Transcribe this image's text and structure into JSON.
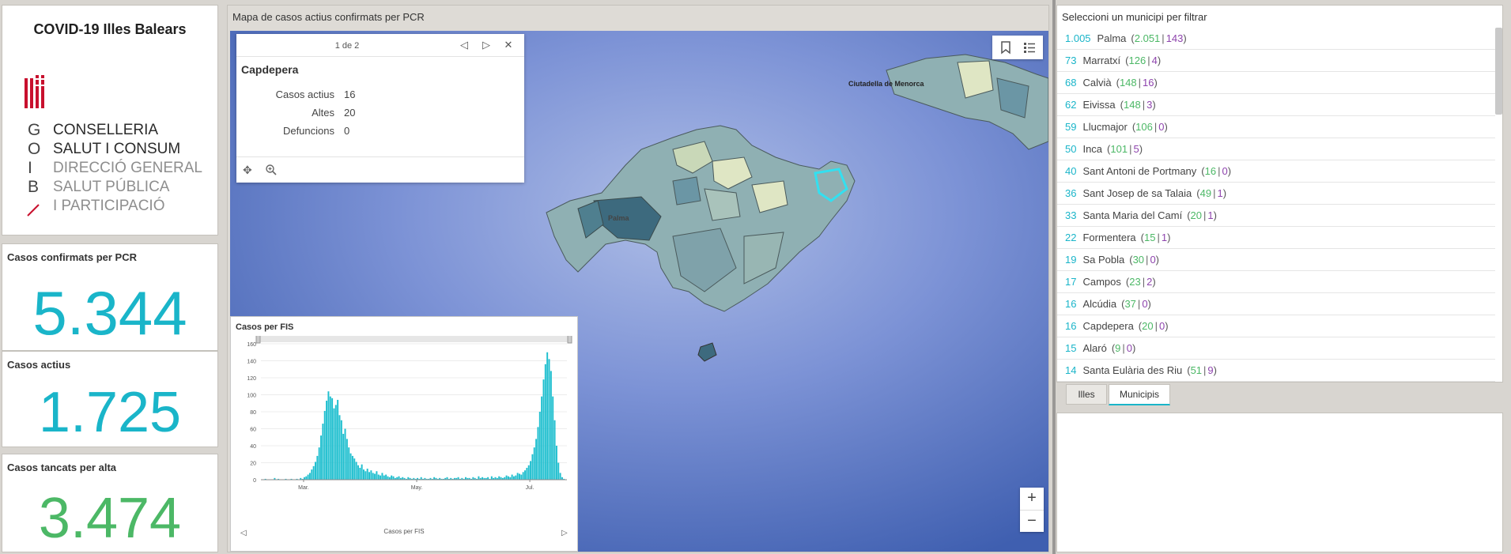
{
  "app": {
    "title": "COVID-19 Illes Balears"
  },
  "logo": {
    "letters": [
      "G",
      "O",
      "I",
      "B"
    ],
    "lines": [
      "CONSELLERIA",
      "SALUT I CONSUM",
      "DIRECCIÓ GENERAL",
      "SALUT PÚBLICA",
      "I PARTICIPACIÓ"
    ],
    "flag_color": "#c8102e"
  },
  "kpis": {
    "pcr": {
      "label": "Casos confirmats per PCR",
      "value": "5.344"
    },
    "actius": {
      "label": "Casos actius",
      "value": "1.725"
    },
    "altes": {
      "label": "Casos tancats per alta",
      "value": "3.474"
    }
  },
  "map": {
    "title": "Mapa de casos actius confirmats per PCR",
    "labels": {
      "city": "Ciutadella de Menorca",
      "palma": "Palma"
    },
    "popup": {
      "pager": "1 de 2",
      "title": "Capdepera",
      "fields": [
        {
          "label": "Casos actius",
          "value": "16"
        },
        {
          "label": "Altes",
          "value": "20"
        },
        {
          "label": "Defuncions",
          "value": "0"
        }
      ]
    },
    "zoom": {
      "in": "+",
      "out": "−"
    }
  },
  "chart_data": {
    "type": "bar",
    "title": "Casos per FIS",
    "xlabel": "Casos per FIS",
    "ylabel": "",
    "ylim": [
      0,
      160
    ],
    "yticks": [
      0,
      20,
      40,
      60,
      80,
      100,
      120,
      140,
      160
    ],
    "xticks": [
      "Mar.",
      "May.",
      "Jul."
    ],
    "xtick_index": [
      23,
      84,
      145
    ],
    "values": [
      0,
      0,
      1,
      0,
      0,
      0,
      0,
      2,
      0,
      1,
      0,
      0,
      0,
      1,
      0,
      0,
      1,
      0,
      0,
      1,
      0,
      2,
      1,
      3,
      4,
      6,
      8,
      12,
      16,
      21,
      28,
      38,
      52,
      66,
      81,
      93,
      104,
      98,
      96,
      84,
      88,
      94,
      76,
      70,
      54,
      60,
      48,
      38,
      31,
      28,
      25,
      21,
      17,
      14,
      18,
      12,
      10,
      13,
      9,
      11,
      8,
      7,
      10,
      6,
      5,
      8,
      5,
      6,
      4,
      3,
      5,
      4,
      2,
      3,
      4,
      2,
      3,
      2,
      1,
      3,
      2,
      1,
      2,
      1,
      2,
      1,
      3,
      1,
      2,
      1,
      1,
      2,
      1,
      3,
      2,
      1,
      2,
      1,
      1,
      2,
      3,
      1,
      2,
      1,
      2,
      2,
      3,
      1,
      2,
      1,
      3,
      2,
      2,
      1,
      3,
      2,
      1,
      4,
      2,
      3,
      2,
      2,
      3,
      1,
      4,
      2,
      3,
      2,
      4,
      3,
      2,
      3,
      5,
      4,
      3,
      6,
      4,
      5,
      8,
      7,
      6,
      9,
      11,
      14,
      17,
      22,
      30,
      38,
      48,
      62,
      80,
      98,
      118,
      136,
      150,
      142,
      128,
      98,
      70,
      40,
      20,
      8,
      3,
      1,
      0
    ],
    "color": "#1fbfcf"
  },
  "municipis": {
    "title": "Seleccioni un municipi per filtrar",
    "items": [
      {
        "count": "1.005",
        "name": "Palma",
        "altes": "2.051",
        "defuncions": "143"
      },
      {
        "count": "73",
        "name": "Marratxí",
        "altes": "126",
        "defuncions": "4"
      },
      {
        "count": "68",
        "name": "Calvià",
        "altes": "148",
        "defuncions": "16"
      },
      {
        "count": "62",
        "name": "Eivissa",
        "altes": "148",
        "defuncions": "3"
      },
      {
        "count": "59",
        "name": "Llucmajor",
        "altes": "106",
        "defuncions": "0"
      },
      {
        "count": "50",
        "name": "Inca",
        "altes": "101",
        "defuncions": "5"
      },
      {
        "count": "40",
        "name": "Sant Antoni de Portmany",
        "altes": "16",
        "defuncions": "0"
      },
      {
        "count": "36",
        "name": "Sant Josep de sa Talaia",
        "altes": "49",
        "defuncions": "1"
      },
      {
        "count": "33",
        "name": "Santa Maria del Camí",
        "altes": "20",
        "defuncions": "1"
      },
      {
        "count": "22",
        "name": "Formentera",
        "altes": "15",
        "defuncions": "1"
      },
      {
        "count": "19",
        "name": "Sa Pobla",
        "altes": "30",
        "defuncions": "0"
      },
      {
        "count": "17",
        "name": "Campos",
        "altes": "23",
        "defuncions": "2"
      },
      {
        "count": "16",
        "name": "Alcúdia",
        "altes": "37",
        "defuncions": "0"
      },
      {
        "count": "16",
        "name": "Capdepera",
        "altes": "20",
        "defuncions": "0"
      },
      {
        "count": "15",
        "name": "Alaró",
        "altes": "9",
        "defuncions": "0"
      },
      {
        "count": "14",
        "name": "Santa Eulària des Riu",
        "altes": "51",
        "defuncions": "9"
      }
    ]
  },
  "tabs": [
    {
      "label": "Illes",
      "active": false
    },
    {
      "label": "Municipis",
      "active": true
    }
  ],
  "colors": {
    "accent": "#1ab5c9",
    "green": "#4cb866",
    "purple": "#8e44ad"
  }
}
